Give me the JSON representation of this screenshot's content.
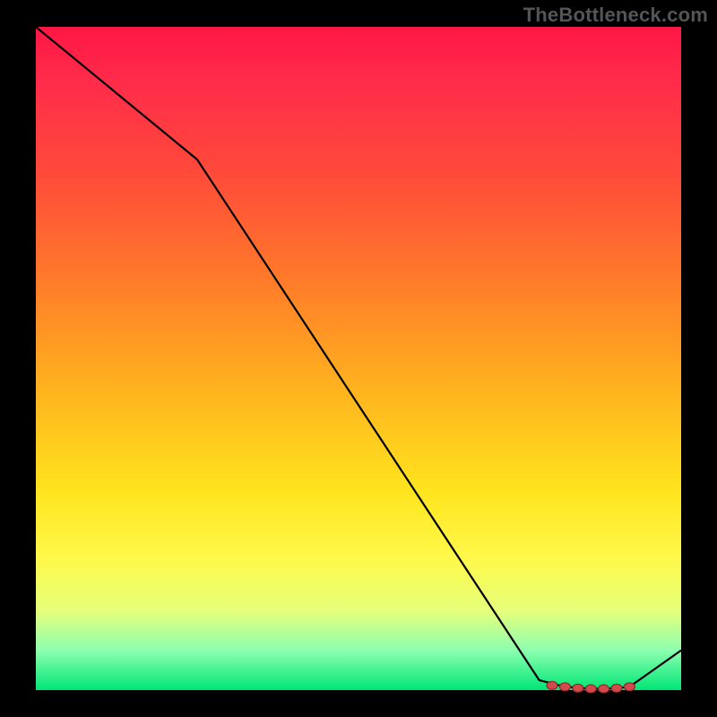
{
  "attribution": "TheBottleneck.com",
  "chart_data": {
    "type": "line",
    "title": "",
    "xlabel": "",
    "ylabel": "",
    "xlim": [
      0,
      1
    ],
    "ylim": [
      0,
      1
    ],
    "x": [
      0.0,
      0.25,
      0.78,
      0.82,
      0.86,
      0.88,
      0.9,
      0.92,
      1.0
    ],
    "y": [
      1.0,
      0.8,
      0.015,
      0.005,
      0.002,
      0.002,
      0.003,
      0.005,
      0.06
    ],
    "markers": {
      "x": [
        0.8,
        0.82,
        0.84,
        0.86,
        0.88,
        0.9,
        0.92
      ],
      "y": [
        0.007,
        0.005,
        0.003,
        0.002,
        0.002,
        0.003,
        0.005
      ]
    },
    "background_gradient": [
      "#ff1744",
      "#ffb41e",
      "#fff94a",
      "#00e676"
    ]
  }
}
